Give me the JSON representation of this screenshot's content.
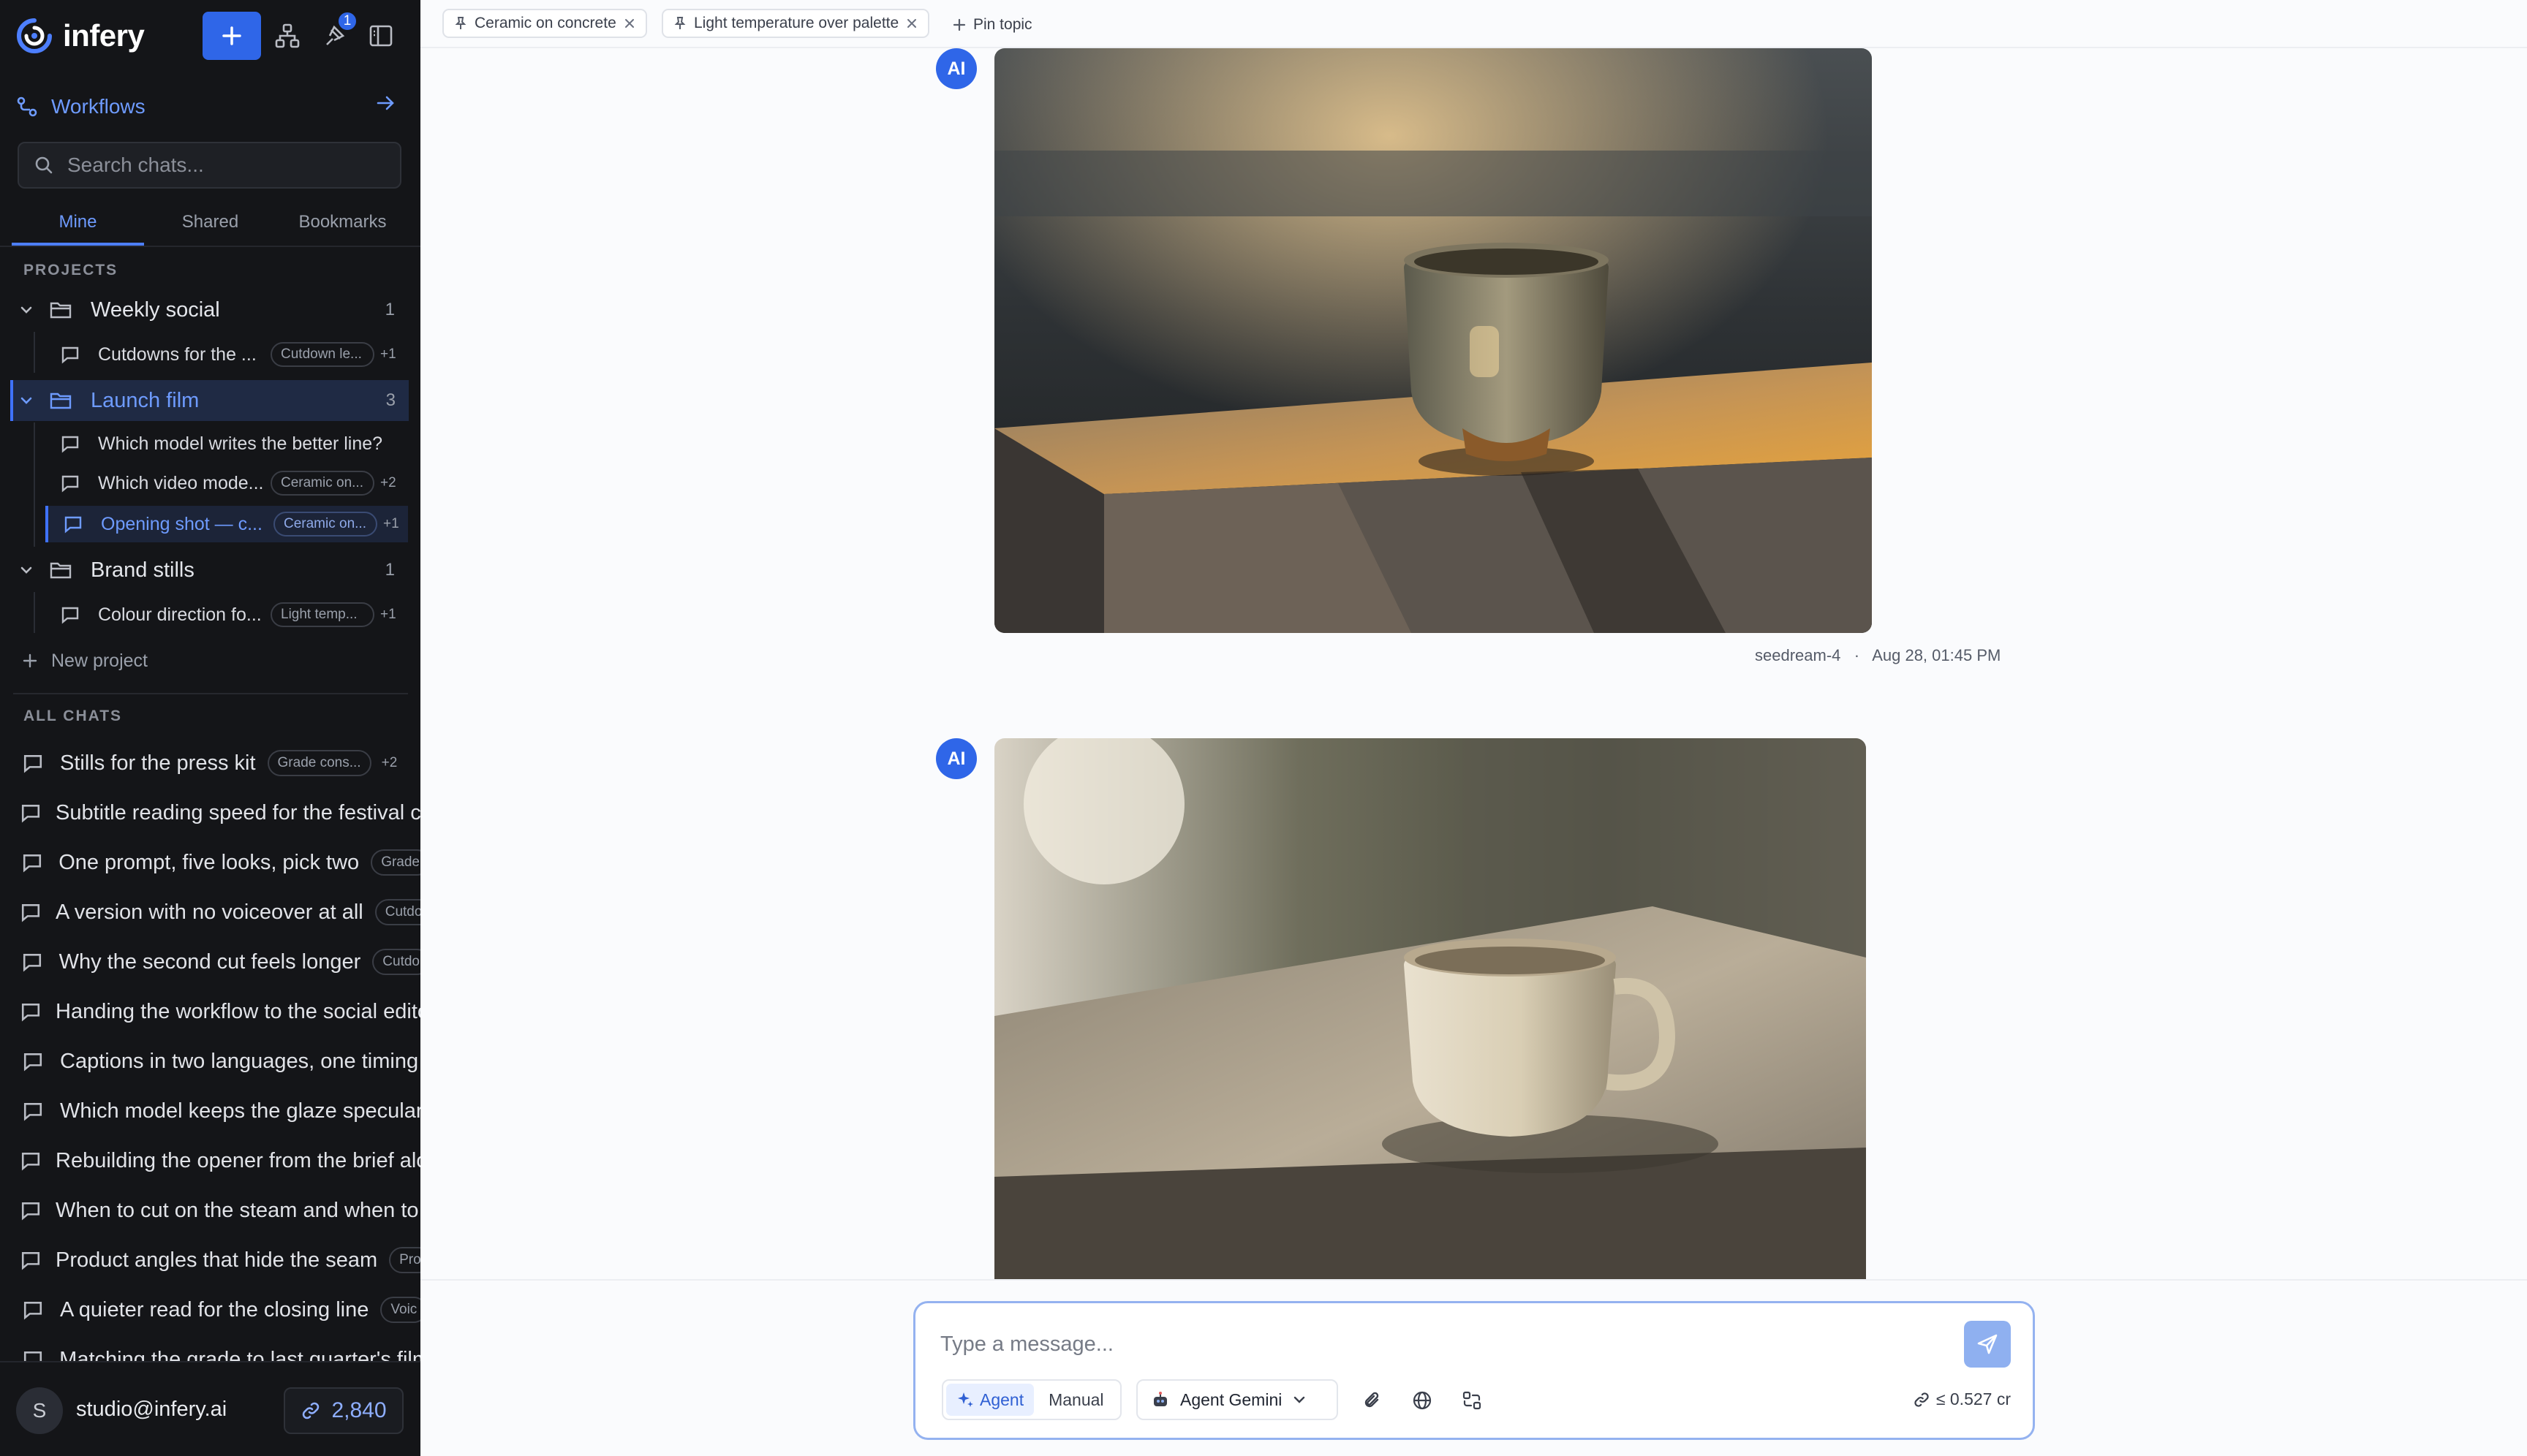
{
  "app": {
    "name": "infery",
    "notification_count": "1"
  },
  "sidebar": {
    "workflows_label": "Workflows",
    "search_placeholder": "Search chats...",
    "tabs": [
      "Mine",
      "Shared",
      "Bookmarks"
    ],
    "projects_heading": "PROJECTS",
    "projects": [
      {
        "name": "Weekly social",
        "count": "1",
        "chats": [
          {
            "title": "Cutdowns for the ...",
            "tag": "Cutdown le...",
            "extra": "+1"
          }
        ]
      },
      {
        "name": "Launch film",
        "count": "3",
        "chats": [
          {
            "title": "Which model writes the better line?",
            "tag": "",
            "extra": ""
          },
          {
            "title": "Which video mode...",
            "tag": "Ceramic on...",
            "extra": "+2"
          },
          {
            "title": "Opening shot — c...",
            "tag": "Ceramic on...",
            "extra": "+1"
          }
        ]
      },
      {
        "name": "Brand stills",
        "count": "1",
        "chats": [
          {
            "title": "Colour direction fo...",
            "tag": "Light temp...",
            "extra": "+1"
          }
        ]
      }
    ],
    "new_project_label": "New project",
    "all_chats_heading": "ALL CHATS",
    "all_chats": [
      {
        "title": "Stills for the press kit",
        "tag": "Grade cons...",
        "extra": "+2"
      },
      {
        "title": "Subtitle reading speed for the festival cut",
        "tag": "",
        "extra": ""
      },
      {
        "title": "One prompt, five looks, pick two",
        "tag": "Grade",
        "extra": ""
      },
      {
        "title": "A version with no voiceover at all",
        "tag": "Cutdo",
        "extra": ""
      },
      {
        "title": "Why the second cut feels longer",
        "tag": "Cutdo",
        "extra": ""
      },
      {
        "title": "Handing the workflow to the social editor",
        "tag": "",
        "extra": ""
      },
      {
        "title": "Captions in two languages, one timing",
        "tag": "",
        "extra": ""
      },
      {
        "title": "Which model keeps the glaze specular",
        "tag": "",
        "extra": ""
      },
      {
        "title": "Rebuilding the opener from the brief alone",
        "tag": "",
        "extra": ""
      },
      {
        "title": "When to cut on the steam and when to hold",
        "tag": "",
        "extra": ""
      },
      {
        "title": "Product angles that hide the seam",
        "tag": "Pro",
        "extra": ""
      },
      {
        "title": "A quieter read for the closing line",
        "tag": "Voic",
        "extra": ""
      },
      {
        "title": "Matching the grade to last quarter's film",
        "tag": "",
        "extra": ""
      }
    ],
    "user": {
      "initial": "S",
      "email": "studio@infery.ai",
      "credits": "2,840"
    }
  },
  "topics": {
    "pinned": [
      "Ceramic on concrete",
      "Light temperature over palette"
    ],
    "pin_label": "Pin topic"
  },
  "messages": [
    {
      "sender": "AI",
      "model": "seedream-4",
      "timestamp": "Aug 28, 01:45 PM"
    },
    {
      "sender": "AI"
    }
  ],
  "composer": {
    "placeholder": "Type a message...",
    "mode_agent": "Agent",
    "mode_manual": "Manual",
    "model_label": "Agent Gemini",
    "cost": "≤ 0.527 cr"
  },
  "colors": {
    "accent": "#2f66e8",
    "sidebar_bg": "#141518",
    "main_bg": "#fafbfd"
  }
}
